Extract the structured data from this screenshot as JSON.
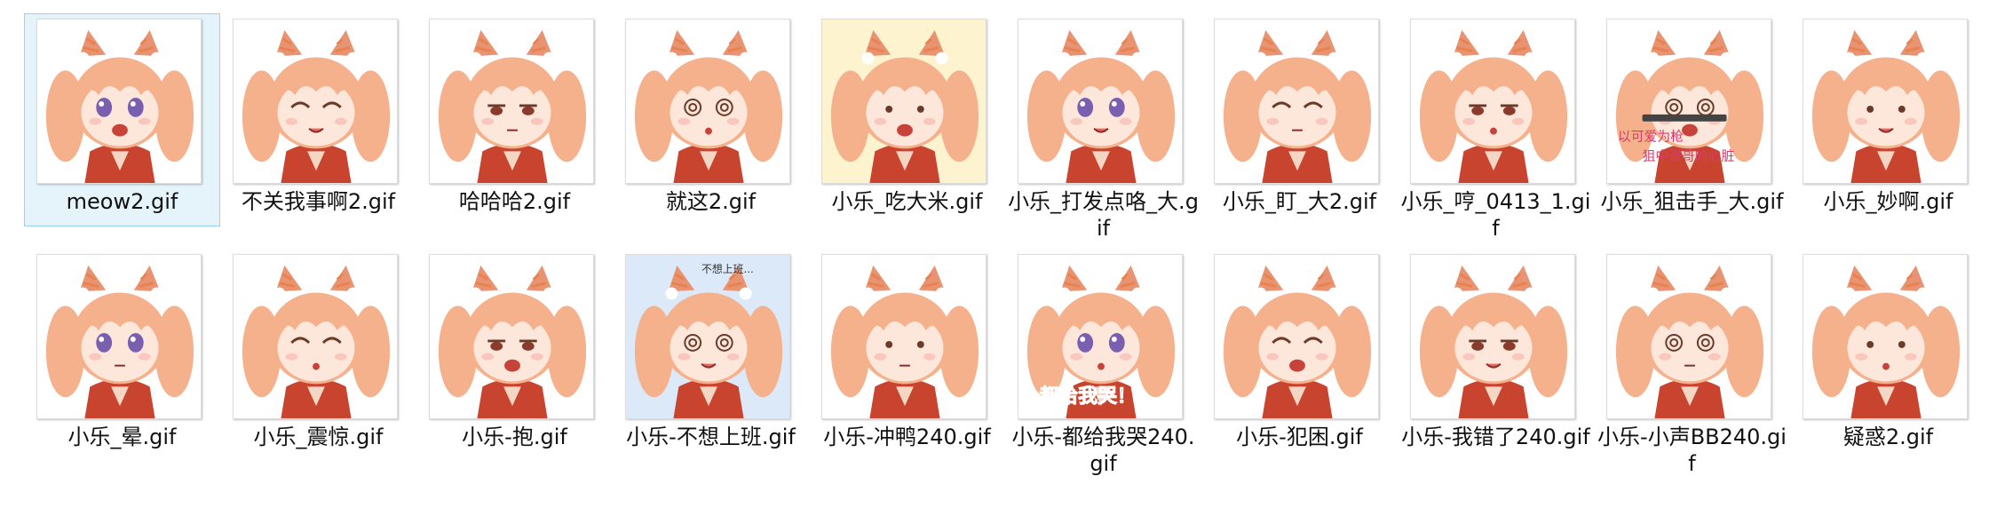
{
  "files": [
    {
      "name": "meow2.gif",
      "selected": true,
      "bg": "#ffffff"
    },
    {
      "name": "不关我事啊2.gif",
      "selected": false,
      "bg": "#ffffff"
    },
    {
      "name": "哈哈哈2.gif",
      "selected": false,
      "bg": "#ffffff"
    },
    {
      "name": "就这2.gif",
      "selected": false,
      "bg": "#ffffff"
    },
    {
      "name": "小乐_吃大米.gif",
      "selected": false,
      "bg": "#fdf4cf"
    },
    {
      "name": "小乐_打发点咯_大.gif",
      "selected": false,
      "bg": "#ffffff"
    },
    {
      "name": "小乐_盯_大2.gif",
      "selected": false,
      "bg": "#ffffff"
    },
    {
      "name": "小乐_哼_0413_1.gif",
      "selected": false,
      "bg": "#ffffff"
    },
    {
      "name": "小乐_狙击手_大.gif",
      "selected": false,
      "bg": "#ffffff"
    },
    {
      "name": "小乐_妙啊.gif",
      "selected": false,
      "bg": "#ffffff"
    },
    {
      "name": "小乐_晕.gif",
      "selected": false,
      "bg": "#ffffff"
    },
    {
      "name": "小乐_震惊.gif",
      "selected": false,
      "bg": "#ffffff"
    },
    {
      "name": "小乐-抱.gif",
      "selected": false,
      "bg": "#ffffff"
    },
    {
      "name": "小乐-不想上班.gif",
      "selected": false,
      "bg": "#dbe9f8"
    },
    {
      "name": "小乐-冲鸭240.gif",
      "selected": false,
      "bg": "#ffffff"
    },
    {
      "name": "小乐-都给我哭240.gif",
      "selected": false,
      "bg": "#ffffff"
    },
    {
      "name": "小乐-犯困.gif",
      "selected": false,
      "bg": "#ffffff"
    },
    {
      "name": "小乐-我错了240.gif",
      "selected": false,
      "bg": "#ffffff"
    },
    {
      "name": "小乐-小声BB240.gif",
      "selected": false,
      "bg": "#ffffff"
    },
    {
      "name": "疑惑2.gif",
      "selected": false,
      "bg": "#ffffff"
    }
  ],
  "thumb_text": {
    "sniper_caption_1": "以可爱为枪",
    "sniper_caption_2": "狙中哥哥的心脏",
    "nowork_caption": "不想上班...",
    "cry_caption": "都给我哭！"
  },
  "colors": {
    "selection_bg": "#e5f3fb",
    "selection_border": "#99d1f5",
    "hair": "#f5b08c",
    "hair_dark": "#e89371",
    "ear_stripe": "#e8824f",
    "eye": "#7a5fb0",
    "outfit": "#c9442e"
  },
  "icons": [
    "gif-thumbnail"
  ]
}
